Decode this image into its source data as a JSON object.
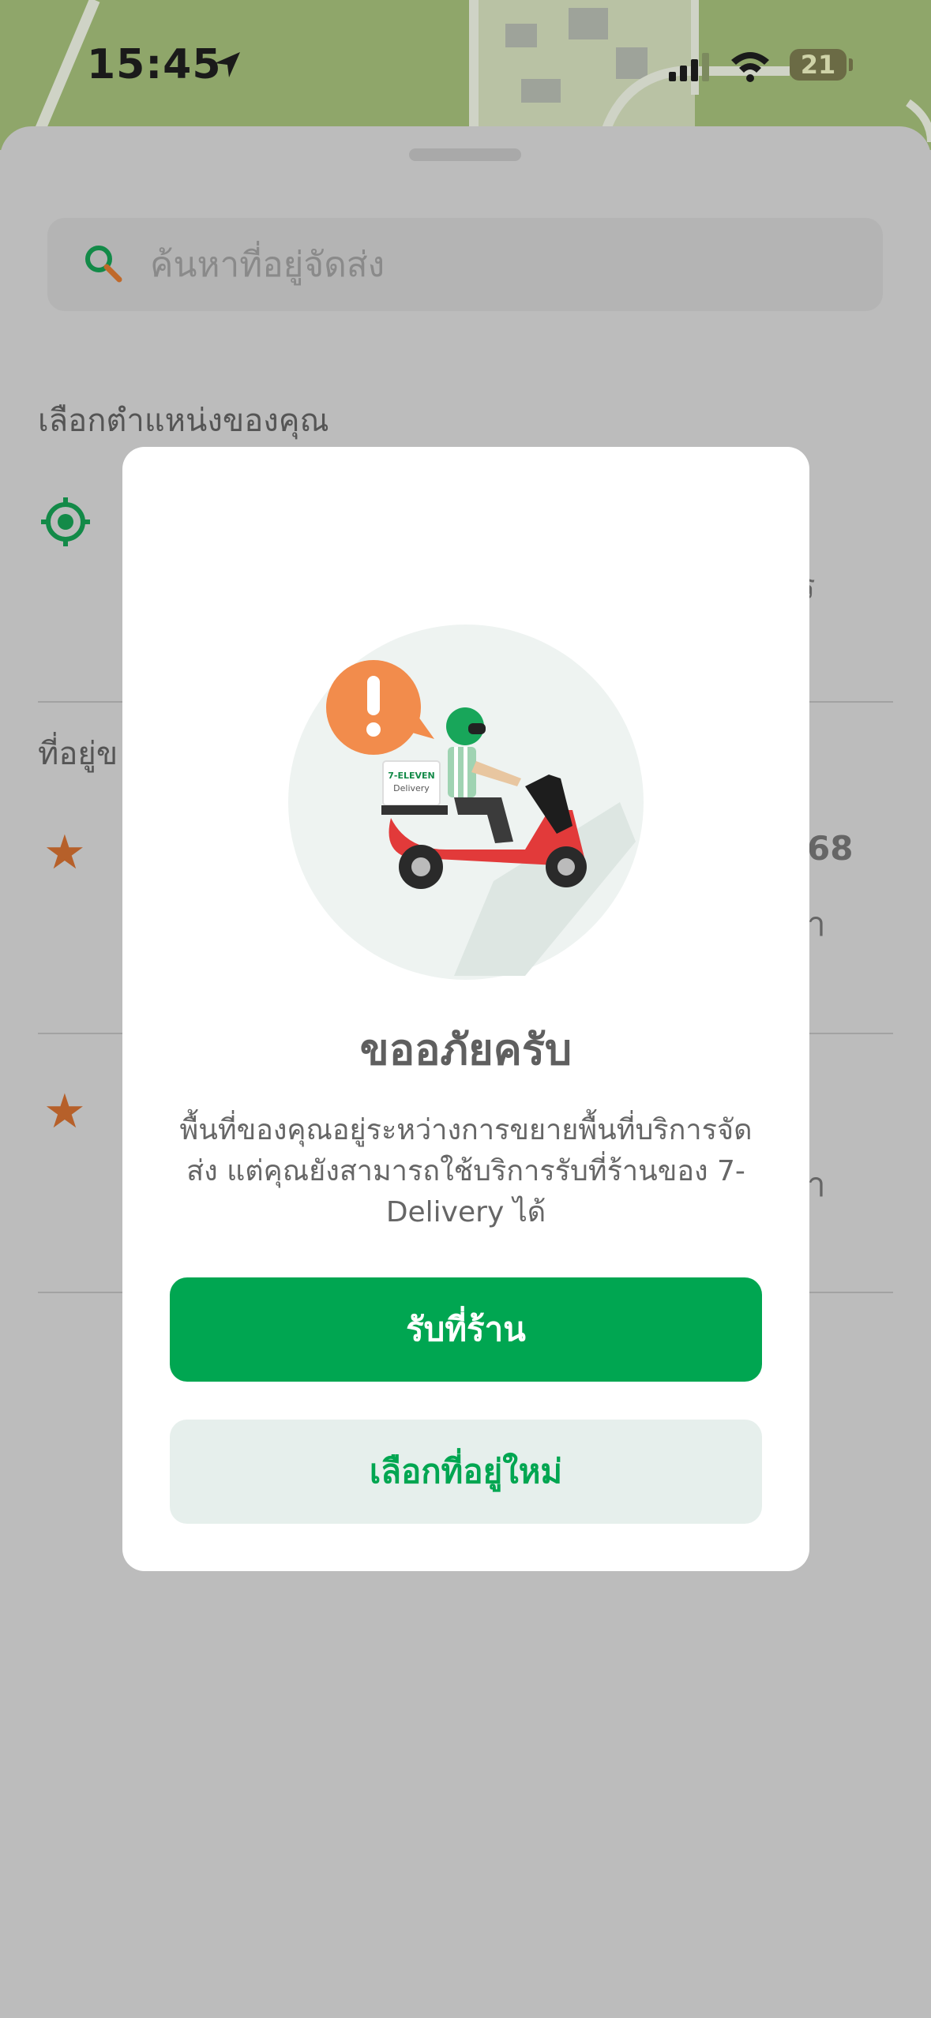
{
  "status_bar": {
    "time": "15:45",
    "battery": "21"
  },
  "search": {
    "placeholder": "ค้นหาที่อยู่จัดส่ง"
  },
  "background": {
    "select_location_title": "เลือกตำแหน่งของคุณ",
    "saved_addresses_title": "ที่อยู่ข",
    "fragment_1": "ร",
    "fragment_2": "68",
    "fragment_3": "า",
    "fragment_4": "า"
  },
  "modal": {
    "title": "ขออภัยครับ",
    "body": "พื้นที่ของคุณอยู่ระหว่างการขยายพื้นที่บริการจัดส่ง แต่คุณยังสามารถใช้บริการรับที่ร้านของ 7-Delivery ได้",
    "primary_button": "รับที่ร้าน",
    "secondary_button": "เลือกที่อยู่ใหม่",
    "illustration_box_line1": "7-ELEVEN",
    "illustration_box_line2": "Delivery"
  },
  "colors": {
    "brand_green": "#00a651",
    "accent_orange": "#f28c4c",
    "star_orange": "#b6602a"
  }
}
